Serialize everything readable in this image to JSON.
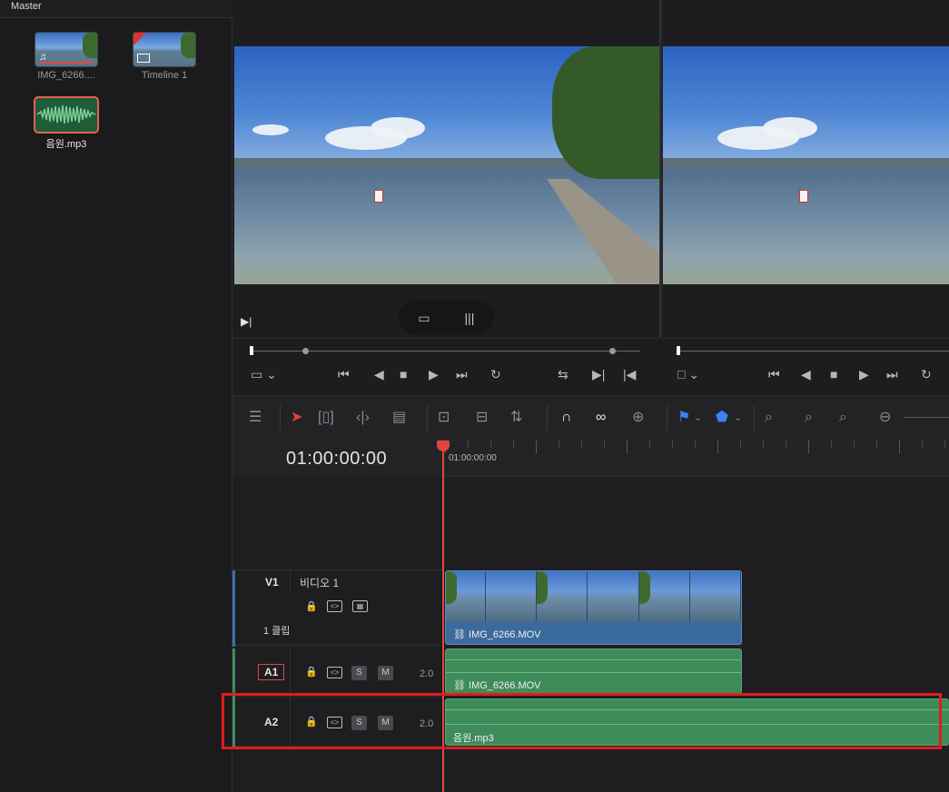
{
  "media_pool": {
    "header": "Master",
    "items": [
      {
        "label": "IMG_6266....",
        "kind": "video",
        "icon": "music-note-icon"
      },
      {
        "label": "Timeline 1",
        "kind": "timeline",
        "icon": "timeline-icon"
      },
      {
        "label": "음원.mp3",
        "kind": "audio",
        "selected": true
      }
    ]
  },
  "viewer": {
    "mode_icons": [
      "film-icon",
      "waveform-icon"
    ]
  },
  "timeline": {
    "timecode": "01:00:00:00",
    "ruler_label": "01:00:00:00",
    "tracks": [
      {
        "id": "V1",
        "name": "비디오 1",
        "clip_count": "1 클립",
        "color": "#3d6fa8"
      },
      {
        "id": "A1",
        "volume": "2.0",
        "solo": "S",
        "mute": "M",
        "color": "#3f8c5b"
      },
      {
        "id": "A2",
        "volume": "2.0",
        "solo": "S",
        "mute": "M",
        "color": "#3f8c5b"
      }
    ],
    "clips": {
      "video": "IMG_6266.MOV",
      "audio1": "IMG_6266.MOV",
      "audio2": "음원.mp3"
    }
  },
  "colors": {
    "playhead": "#e0463c",
    "highlight": "#e11d1d",
    "video_clip": "#3b6b9c",
    "audio_clip": "#3f8c5b"
  }
}
